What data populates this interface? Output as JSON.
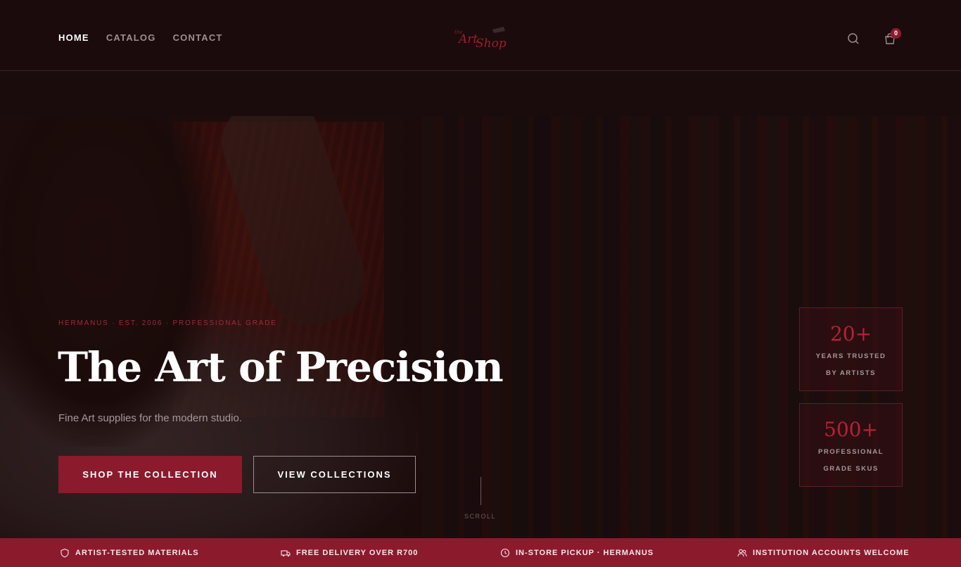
{
  "nav": {
    "items": [
      "HOME",
      "CATALOG",
      "CONTACT"
    ]
  },
  "logo": {
    "text_top": "the",
    "text_main": "Art Shop"
  },
  "cart": {
    "count": "0"
  },
  "hero": {
    "eyebrow": "HERMANUS · EST. 2006 · PROFESSIONAL GRADE",
    "title": "The Art of Precision",
    "subtitle": "Fine Art supplies for the modern studio.",
    "primary_cta": "SHOP THE COLLECTION",
    "secondary_cta": "VIEW COLLECTIONS",
    "scroll_label": "SCROLL"
  },
  "stats": [
    {
      "value": "20+",
      "label_line1": "YEARS TRUSTED",
      "label_line2": "BY ARTISTS"
    },
    {
      "value": "500+",
      "label_line1": "PROFESSIONAL",
      "label_line2": "GRADE SKUS"
    }
  ],
  "features": [
    {
      "icon": "shield-icon",
      "label": "ARTIST-TESTED MATERIALS"
    },
    {
      "icon": "truck-icon",
      "label": "FREE DELIVERY OVER R700"
    },
    {
      "icon": "clock-icon",
      "label": "IN-STORE PICKUP · HERMANUS"
    },
    {
      "icon": "users-icon",
      "label": "INSTITUTION ACCOUNTS WELCOME"
    }
  ],
  "colors": {
    "accent": "#8b1a2d",
    "background": "#1a0b0c",
    "stat_value": "#b52238"
  }
}
